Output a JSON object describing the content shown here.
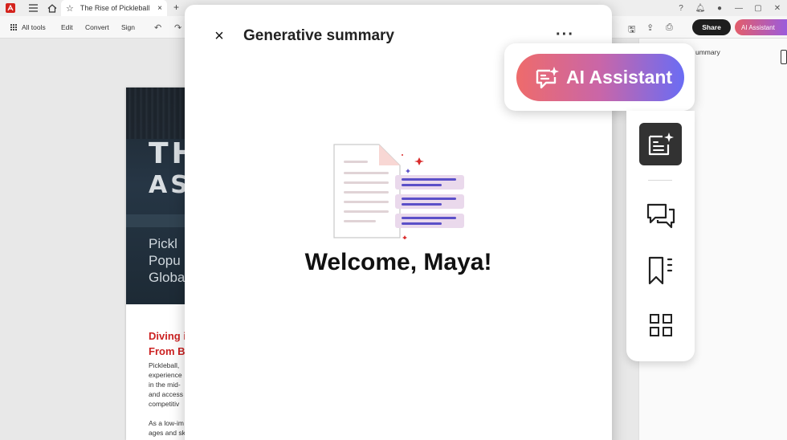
{
  "browser": {
    "tab_title": "The Rise of Pickleball",
    "tab_close": "×",
    "new_tab": "+"
  },
  "toolbar": {
    "all_tools": "All tools",
    "edit": "Edit",
    "convert": "Convert",
    "sign": "Sign",
    "share": "Share",
    "ai_assistant": "AI Assistant"
  },
  "right_panel": {
    "text": "ummary"
  },
  "document": {
    "hero_line1": "TH",
    "hero_line2": "AS",
    "hero_sub": [
      "Pickl",
      "Popu",
      "Globa"
    ],
    "article_head": [
      "Diving i",
      "From Ba"
    ],
    "article_body": [
      "Pickleball,",
      "experience",
      "in the mid-",
      "and access",
      "competitiv",
      "",
      "As a low-im",
      "ages and sk"
    ]
  },
  "modal": {
    "title": "Generative summary",
    "close": "×",
    "more": "···",
    "welcome": "Welcome, Maya!"
  },
  "ai_popover": {
    "label": "AI Assistant"
  },
  "colors": {
    "accent_red": "#cc2222",
    "ai_gradient_start": "#ee6b6b",
    "ai_gradient_end": "#6a6cf4",
    "share_bg": "#1e1e1e",
    "rail_active": "#323232"
  },
  "icons": [
    "acrobat-icon",
    "menu-icon",
    "home-icon",
    "star-icon",
    "apps-grid-icon",
    "undo-icon",
    "redo-icon",
    "save-icon",
    "upload-icon",
    "print-icon",
    "help-icon",
    "bell-icon",
    "avatar",
    "generative-summary-icon",
    "comment-icon",
    "bookmark-icon",
    "thumbnails-icon",
    "close-icon",
    "more-icon"
  ]
}
